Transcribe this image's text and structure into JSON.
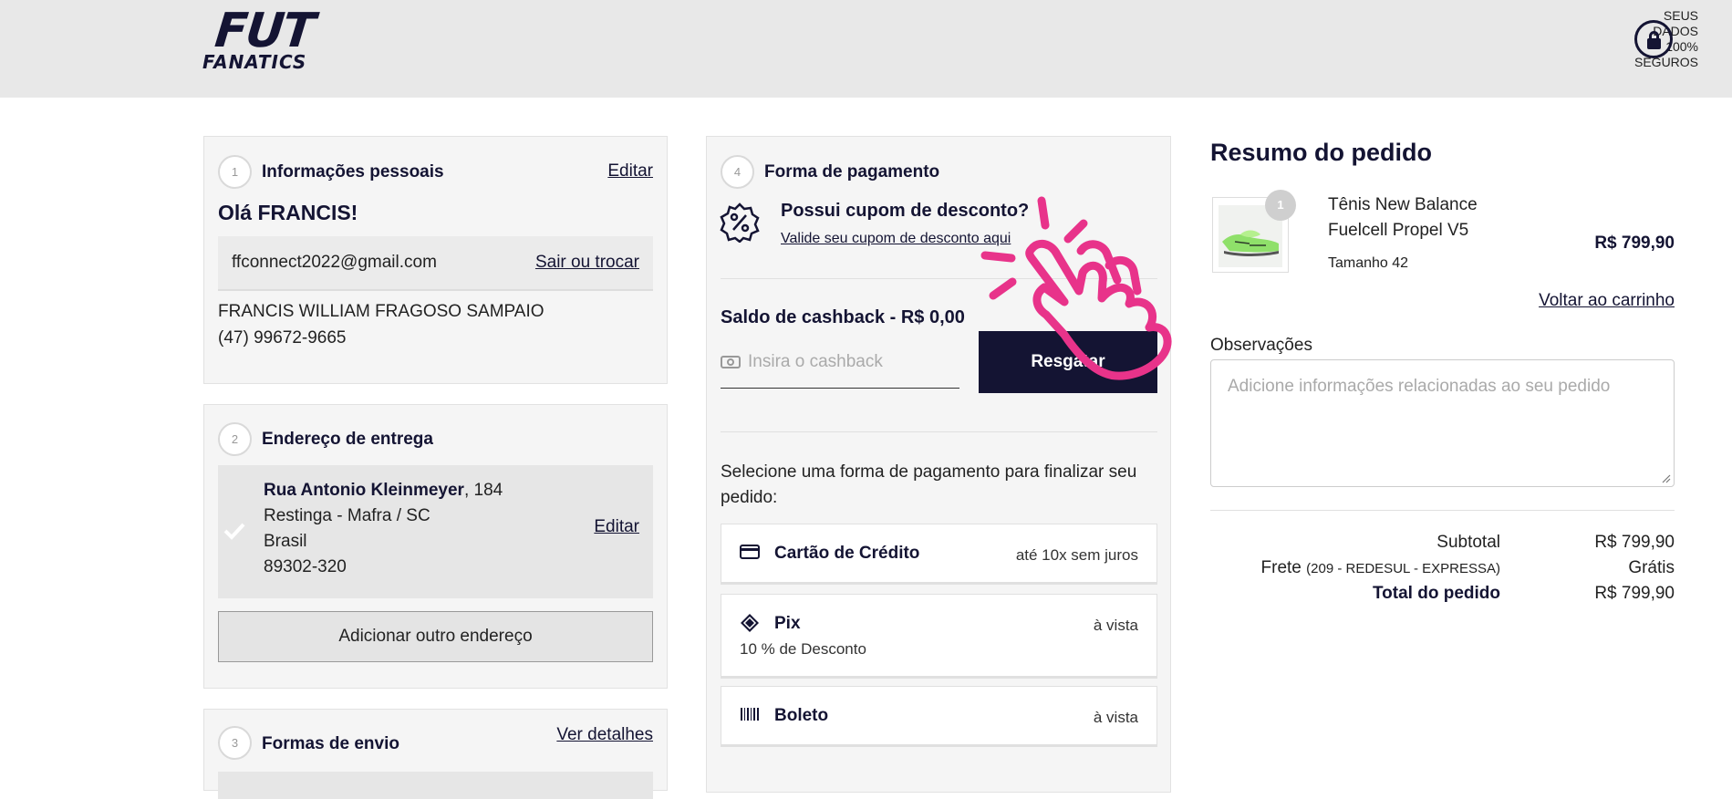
{
  "header": {
    "logo_line1": "FUT",
    "logo_line2": "FANATICS",
    "secure_line1": "SEUS DADOS",
    "secure_line2": "100% SEGUROS",
    "lock_icon": "lock-icon"
  },
  "personal": {
    "step": "1",
    "title": "Informações pessoais",
    "edit_label": "Editar",
    "greeting": "Olá FRANCIS!",
    "email": "ffconnect2022@gmail.com",
    "switch_label": "Sair ou trocar",
    "name": "FRANCIS WILLIAM FRAGOSO SAMPAIO",
    "phone": "(47) 99672-9665"
  },
  "delivery": {
    "step": "2",
    "title": "Endereço de entrega",
    "street": "Rua Antonio Kleinmeyer",
    "number": ", 184",
    "city": "Restinga - Mafra / SC",
    "country": "Brasil",
    "zip": "89302-320",
    "edit_label": "Editar",
    "add_label": "Adicionar outro endereço"
  },
  "shipping": {
    "step": "3",
    "title": "Formas de envio",
    "details_label": "Ver detalhes"
  },
  "payment": {
    "step": "4",
    "title": "Forma de pagamento",
    "coupon_title": "Possui cupom de desconto?",
    "coupon_link": "Valide seu cupom de desconto aqui",
    "cashback_title": "Saldo de cashback - R$ 0,00",
    "cashback_placeholder": "Insira o cashback",
    "redeem_label": "Resgatar",
    "select_text": "Selecione uma forma de pagamento para finalizar seu pedido:",
    "options": [
      {
        "name": "Cartão de Crédito",
        "meta": "até 10x sem juros",
        "icon": "credit-card-icon"
      },
      {
        "name": "Pix",
        "meta": "à vista",
        "sub": "10 % de Desconto",
        "icon": "pix-icon"
      },
      {
        "name": "Boleto",
        "meta": "à vista",
        "icon": "barcode-icon"
      }
    ]
  },
  "summary": {
    "title": "Resumo do pedido",
    "qty": "1",
    "product_name_line1": "Tênis New Balance",
    "product_name_line2": "Fuelcell Propel V5",
    "size": "Tamanho 42",
    "price": "R$ 799,90",
    "back_to_cart": "Voltar ao carrinho",
    "notes_label": "Observações",
    "notes_placeholder": "Adicione informações relacionadas ao seu pedido",
    "subtotal_label": "Subtotal",
    "subtotal_value": "R$ 799,90",
    "shipping_label": "Frete",
    "shipping_detail": "(209 - REDESUL - EXPRESSA)",
    "shipping_value": "Grátis",
    "total_label": "Total do pedido",
    "total_value": "R$ 799,90"
  },
  "colors": {
    "brand_dark": "#141433",
    "overlay_pink": "#e8338a"
  }
}
